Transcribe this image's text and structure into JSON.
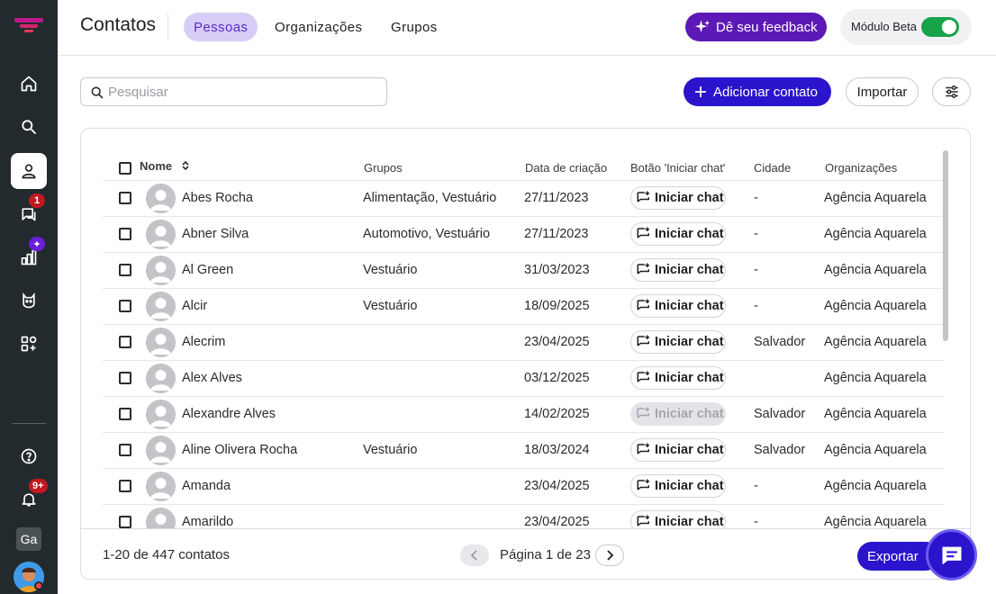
{
  "sidebar": {
    "items": [
      {
        "name": "home-icon"
      },
      {
        "name": "search-icon"
      },
      {
        "name": "contacts-icon",
        "active": true
      },
      {
        "name": "chat-icon",
        "badge": "1"
      },
      {
        "name": "reports-icon",
        "badge": "✦"
      },
      {
        "name": "bot-icon"
      },
      {
        "name": "apps-icon"
      }
    ],
    "help_icon": "help-icon",
    "notifications_badge": "9+",
    "workspace_initials": "Ga"
  },
  "header": {
    "title": "Contatos",
    "tabs": [
      "Pessoas",
      "Organizações",
      "Grupos"
    ],
    "active_tab": "Pessoas",
    "feedback_label": "Dê seu feedback",
    "beta_label": "Módulo Beta",
    "beta_enabled": true
  },
  "toolbar": {
    "search_placeholder": "Pesquisar",
    "add_label": "Adicionar contato",
    "import_label": "Importar"
  },
  "table": {
    "columns": {
      "name": "Nome",
      "groups": "Grupos",
      "created": "Data de criação",
      "chat_button": "Botão 'Iniciar chat'",
      "city": "Cidade",
      "orgs": "Organizações"
    },
    "chat_label": "Iniciar chat",
    "rows": [
      {
        "name": "Abes Rocha",
        "groups": "Alimentação, Vestuário",
        "created": "27/11/2023",
        "city": "-",
        "org": "Agência Aquarela",
        "chat_enabled": true
      },
      {
        "name": "Abner Silva",
        "groups": "Automotivo, Vestuário",
        "created": "27/11/2023",
        "city": "-",
        "org": "Agência Aquarela",
        "chat_enabled": true
      },
      {
        "name": "Al Green",
        "groups": "Vestuário",
        "created": "31/03/2023",
        "city": "-",
        "org": "Agência Aquarela",
        "chat_enabled": true
      },
      {
        "name": "Alcir",
        "groups": "Vestuário",
        "created": "18/09/2025",
        "city": "-",
        "org": "Agência Aquarela",
        "chat_enabled": true
      },
      {
        "name": "Alecrim",
        "groups": "",
        "created": "23/04/2025",
        "city": "Salvador",
        "org": "Agência Aquarela",
        "chat_enabled": true
      },
      {
        "name": "Alex Alves",
        "groups": "",
        "created": "03/12/2025",
        "city": "",
        "org": "Agência Aquarela",
        "chat_enabled": true
      },
      {
        "name": "Alexandre Alves",
        "groups": "",
        "created": "14/02/2025",
        "city": "Salvador",
        "org": "Agência Aquarela",
        "chat_enabled": false
      },
      {
        "name": "Aline Olivera Rocha",
        "groups": "Vestuário",
        "created": "18/03/2024",
        "city": "Salvador",
        "org": "Agência Aquarela",
        "chat_enabled": true
      },
      {
        "name": "Amanda",
        "groups": "",
        "created": "23/04/2025",
        "city": "-",
        "org": "Agência Aquarela",
        "chat_enabled": true
      },
      {
        "name": "Amarildo",
        "groups": "",
        "created": "23/04/2025",
        "city": "-",
        "org": "Agência Aquarela",
        "chat_enabled": true
      }
    ]
  },
  "footer": {
    "count_text": "1-20 de 447 contatos",
    "page_text": "Página 1 de 23",
    "export_label": "Exportar"
  },
  "colors": {
    "sidebar_bg": "#232a2e",
    "primary": "#2a14cc",
    "feedback": "#5d19b5",
    "active_tab_bg": "#d8cdf7",
    "toggle_on": "#17a34a"
  }
}
